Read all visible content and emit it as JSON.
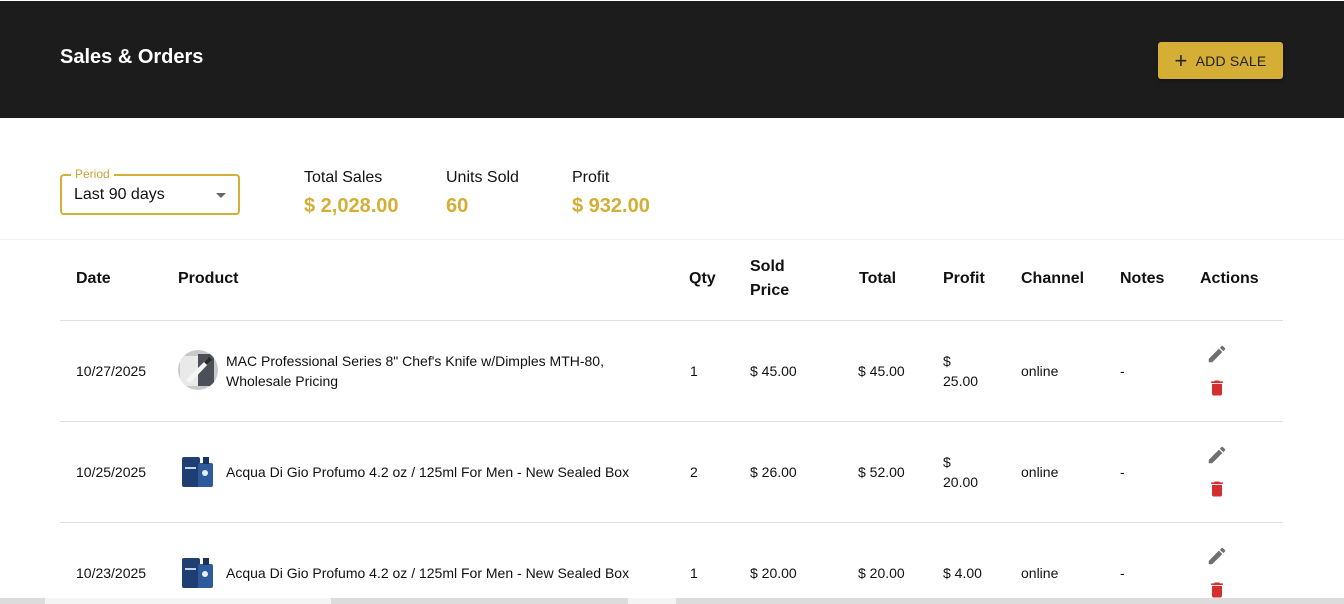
{
  "header": {
    "title": "Sales & Orders",
    "add_label": "ADD SALE"
  },
  "filter": {
    "legend": "Period",
    "value": "Last 90 days"
  },
  "stats": [
    {
      "label": "Total Sales",
      "value": "$ 2,028.00"
    },
    {
      "label": "Units Sold",
      "value": "60"
    },
    {
      "label": "Profit",
      "value": "$ 932.00"
    }
  ],
  "table": {
    "columns": [
      "Date",
      "Product",
      "Qty",
      "Sold Price",
      "Total",
      "Profit",
      "Channel",
      "Notes",
      "Actions"
    ],
    "rows": [
      {
        "date": "10/27/2025",
        "product": "MAC Professional Series 8\" Chef's Knife w/Dimples MTH-80, Wholesale Pricing",
        "thumb": "knife-thumbnail",
        "qty": "1",
        "sold_price": "$ 45.00",
        "total": "$ 45.00",
        "profit": "$ 25.00",
        "channel": "online",
        "notes": "-"
      },
      {
        "date": "10/25/2025",
        "product": "Acqua Di Gio Profumo 4.2 oz / 125ml For Men - New Sealed Box",
        "thumb": "perfume-thumbnail",
        "qty": "2",
        "sold_price": "$ 26.00",
        "total": "$ 52.00",
        "profit": "$ 20.00",
        "channel": "online",
        "notes": "-"
      },
      {
        "date": "10/23/2025",
        "product": "Acqua Di Gio Profumo 4.2 oz / 125ml For Men - New Sealed Box",
        "thumb": "perfume-thumbnail",
        "qty": "1",
        "sold_price": "$ 20.00",
        "total": "$ 20.00",
        "profit": "$ 4.00",
        "channel": "online",
        "notes": "-"
      }
    ]
  },
  "icons": {
    "edit": "pencil-icon",
    "delete": "trash-icon",
    "add": "plus-icon",
    "dropdown": "caret-down-icon"
  },
  "colors": {
    "accent": "#d4ae35",
    "header_bg": "#1c1c1c",
    "delete": "#d32f2f",
    "edit": "#707070"
  }
}
